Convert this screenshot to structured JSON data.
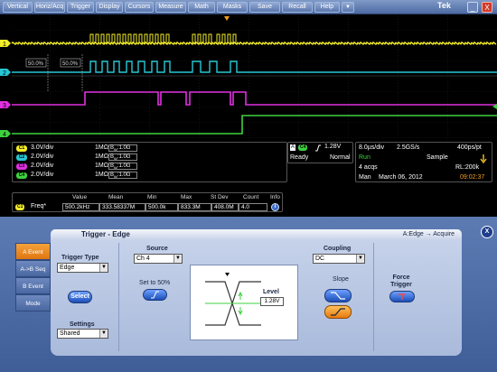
{
  "menu": {
    "items": [
      "Vertical",
      "Horiz/Acq",
      "Trigger",
      "Display",
      "Cursors",
      "Measure",
      "Math",
      "Masks",
      "Save",
      "Recall",
      "Help"
    ],
    "dropdown_arrow": "▼",
    "brand": "Tek",
    "minimize": "_",
    "close": "X"
  },
  "colors": {
    "ch1": "#f2ec2a",
    "ch2": "#27c7d6",
    "ch3": "#e030e0",
    "ch4": "#3ed23e"
  },
  "waveform": {
    "cursor_labels": [
      "50.0%",
      "50.0%"
    ],
    "channel_markers": [
      "1",
      "2",
      "3",
      "4"
    ]
  },
  "channels": [
    {
      "badge": "C1",
      "scale": "3.0V/div",
      "impedance": "1MΩ",
      "bw_prefix": "B",
      "bw_sub": "W",
      "bw_value": ":1.0G"
    },
    {
      "badge": "C2",
      "scale": "2.0V/div",
      "impedance": "1MΩ",
      "bw_prefix": "B",
      "bw_sub": "W",
      "bw_value": ":1.0G"
    },
    {
      "badge": "C3",
      "scale": "2.0V/div",
      "impedance": "1MΩ",
      "bw_prefix": "B",
      "bw_sub": "W",
      "bw_value": ":1.0G"
    },
    {
      "badge": "C4",
      "scale": "2.0V/div",
      "impedance": "1MΩ",
      "bw_prefix": "B",
      "bw_sub": "W",
      "bw_value": ":1.0G"
    }
  ],
  "trigger_readout": {
    "label": "A",
    "source": "C4",
    "level": "1.28V",
    "state": "Ready",
    "mode": "Normal"
  },
  "acquisition": {
    "timebase": "8.0µs/div",
    "sample_rate": "2.5GS/s",
    "resolution": "400ps/pt",
    "run_state": "Run",
    "acq_mode": "Sample",
    "acqs": "4 acqs",
    "record_length": "RL:200k",
    "user": "Man",
    "date": "March 06, 2012",
    "time": "09:02:37"
  },
  "measurement": {
    "headers": [
      "Value",
      "Mean",
      "Min",
      "Max",
      "St Dev",
      "Count",
      "Info"
    ],
    "badge": "C1",
    "name": "Freq*",
    "values": [
      "500.2kHz",
      "333.58337M",
      "500.0k",
      "833.3M",
      "408.0M",
      "4.0"
    ],
    "info_icon": "i"
  },
  "trigger_panel": {
    "title": "Trigger - Edge",
    "sequence": "A:Edge → Acquire",
    "close_label": "X",
    "tabs": [
      "A Event",
      "A->B Seq",
      "B Event",
      "Mode"
    ],
    "trigger_type_label": "Trigger Type",
    "trigger_type_value": "Edge",
    "select_button": "Select",
    "settings_label": "Settings",
    "settings_value": "Shared",
    "source_label": "Source",
    "source_value": "Ch 4",
    "set50_label": "Set to 50%",
    "level_label": "Level",
    "level_value": "1.28V",
    "coupling_label": "Coupling",
    "coupling_value": "DC",
    "slope_label": "Slope",
    "force_trigger_label": "Force Trigger"
  }
}
